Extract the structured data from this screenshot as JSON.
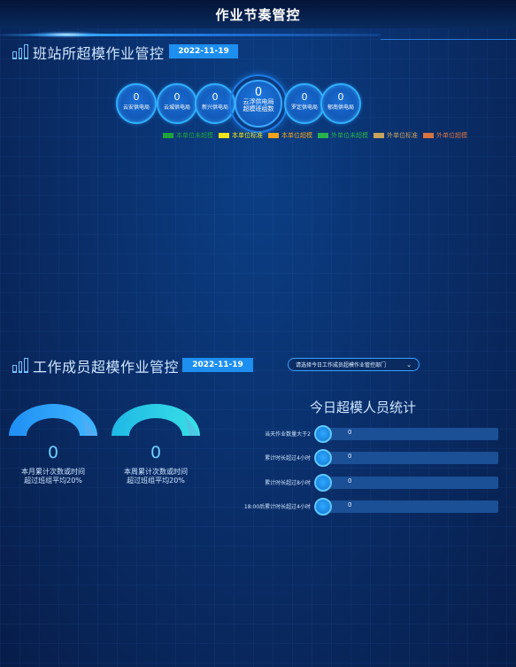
{
  "header": {
    "title": "作业节奏管控"
  },
  "section1": {
    "title": "班站所超模作业管控",
    "date": "2022-11-19",
    "bubbles": [
      {
        "value": "0",
        "name": "云安供电局"
      },
      {
        "value": "0",
        "name": "云城供电局"
      },
      {
        "value": "0",
        "name": "新兴供电局"
      },
      {
        "value": "0",
        "name": "罗定供电局"
      },
      {
        "value": "0",
        "name": "郁南供电局"
      }
    ],
    "center": {
      "value": "0",
      "name1": "云浮供电局",
      "name2": "超模班组数"
    },
    "legend": [
      {
        "label": "本单位未超模",
        "color": "#1fa33a"
      },
      {
        "label": "本单位标准",
        "color": "#f1e418"
      },
      {
        "label": "本单位超模",
        "color": "#f0a21a"
      },
      {
        "label": "外单位未超模",
        "color": "#29b14a"
      },
      {
        "label": "外单位标准",
        "color": "#c7a25a"
      },
      {
        "label": "外单位超模",
        "color": "#d9733e"
      }
    ]
  },
  "section2": {
    "title": "工作成员超模作业管控",
    "date": "2022-11-19",
    "gauges": [
      {
        "value": "0",
        "caption1": "本月累计次数或时间",
        "caption2": "超过班组平均20%",
        "color1": "#1f8ff5",
        "color2": "#3fb6ff"
      },
      {
        "value": "0",
        "caption1": "本周累计次数或时间",
        "caption2": "超过班组平均20%",
        "color1": "#1fb8e6",
        "color2": "#38e0e6"
      }
    ],
    "select": {
      "placeholder": "请选择今日工作成员超模作业管控部门"
    },
    "stats": {
      "title": "今日超模人员统计",
      "rows": [
        {
          "label": "当天作业数量大于2",
          "value": "0"
        },
        {
          "label": "累计时长超过4小时",
          "value": "0"
        },
        {
          "label": "累计时长超过8小时",
          "value": "0"
        },
        {
          "label": "18:00后累计时长超过4小时",
          "value": "0"
        }
      ]
    }
  }
}
